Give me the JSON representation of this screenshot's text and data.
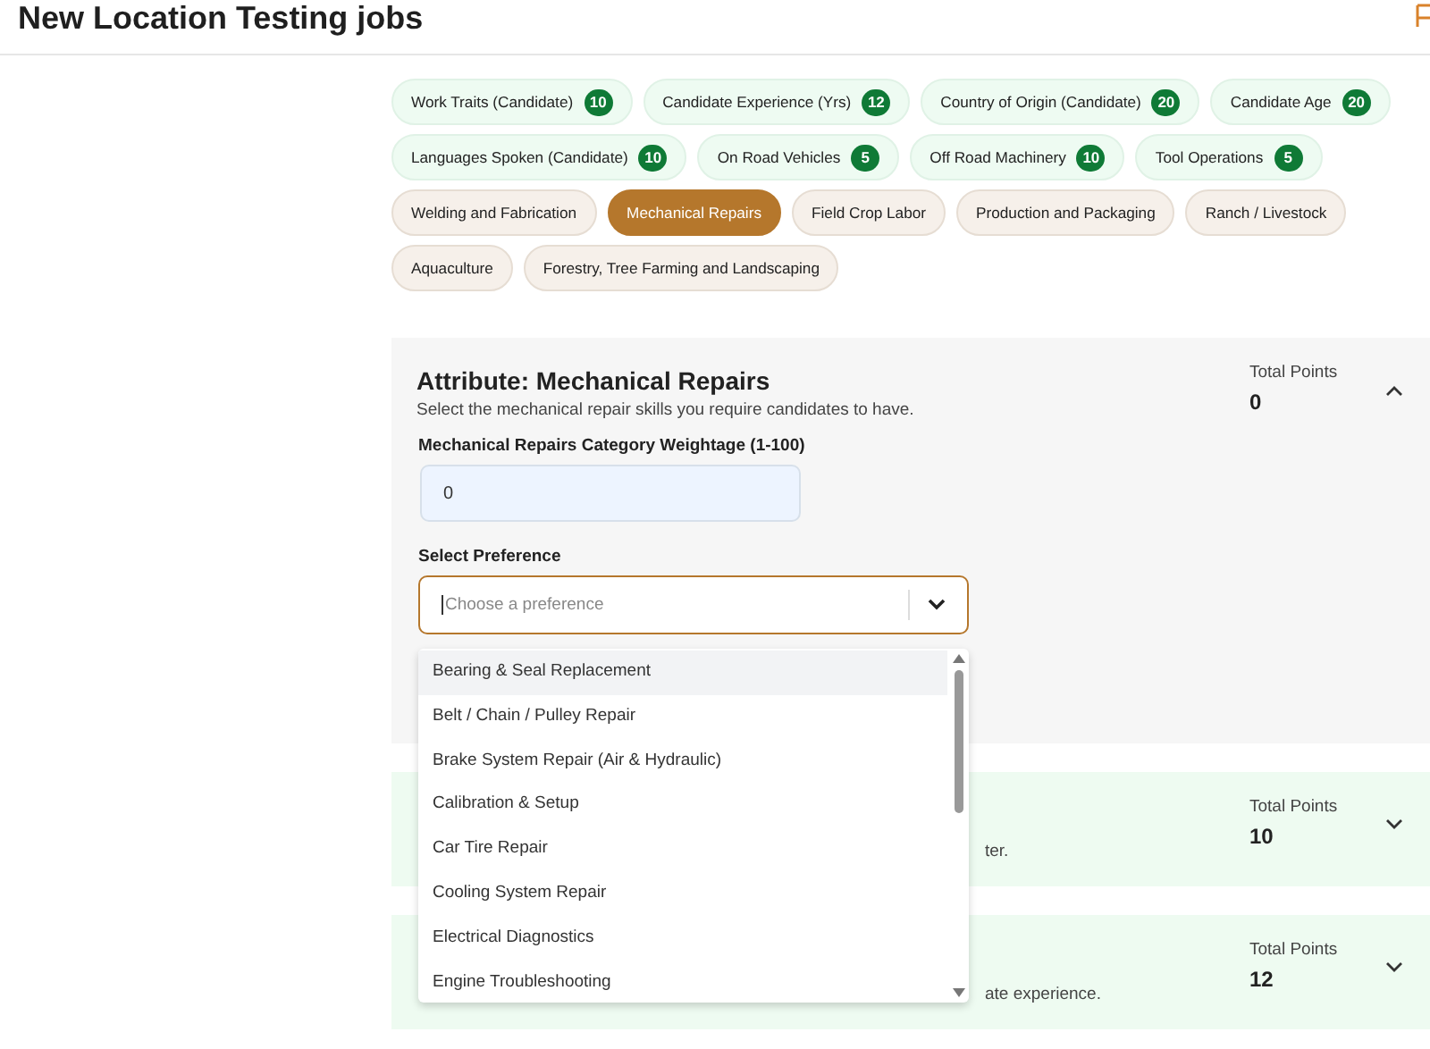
{
  "header": {
    "title": "New Location Testing jobs"
  },
  "attribute_chips": [
    {
      "label": "Work Traits (Candidate)",
      "count": "10"
    },
    {
      "label": "Candidate Experience (Yrs)",
      "count": "12"
    },
    {
      "label": "Country of Origin (Candidate)",
      "count": "20"
    },
    {
      "label": "Candidate Age",
      "count": "20"
    },
    {
      "label": "Languages Spoken (Candidate)",
      "count": "10"
    },
    {
      "label": "On Road Vehicles",
      "count": "5"
    },
    {
      "label": "Off Road Machinery",
      "count": "10"
    },
    {
      "label": "Tool Operations",
      "count": "5"
    }
  ],
  "category_chips": [
    {
      "label": "Welding and Fabrication",
      "selected": false
    },
    {
      "label": "Mechanical Repairs",
      "selected": true
    },
    {
      "label": "Field Crop Labor",
      "selected": false
    },
    {
      "label": "Production and Packaging",
      "selected": false
    },
    {
      "label": "Ranch / Livestock",
      "selected": false
    },
    {
      "label": "Aquaculture",
      "selected": false
    },
    {
      "label": "Forestry, Tree Farming and Landscaping",
      "selected": false
    }
  ],
  "attribute_panel": {
    "title": "Attribute: Mechanical Repairs",
    "description": "Select the mechanical repair skills you require candidates to have.",
    "total_label": "Total Points",
    "total": "0",
    "expanded": true,
    "weightage": {
      "label": "Mechanical Repairs Category Weightage (1-100)",
      "value": "0"
    },
    "preference": {
      "label": "Select Preference",
      "placeholder": "Choose a preference",
      "options": [
        {
          "label": "Bearing & Seal Replacement",
          "highlighted": true
        },
        {
          "label": "Belt / Chain / Pulley Repair",
          "highlighted": false
        },
        {
          "label": "Brake System Repair (Air & Hydraulic)",
          "highlighted": false
        },
        {
          "label": "Calibration & Setup",
          "highlighted": false
        },
        {
          "label": "Car Tire Repair",
          "highlighted": false
        },
        {
          "label": "Cooling System Repair",
          "highlighted": false
        },
        {
          "label": "Electrical Diagnostics",
          "highlighted": false
        },
        {
          "label": "Engine Troubleshooting",
          "highlighted": false
        }
      ]
    }
  },
  "other_panels": [
    {
      "description": "ter.",
      "total_label": "Total Points",
      "total": "10",
      "expanded": false
    },
    {
      "description": "ate experience.",
      "total_label": "Total Points",
      "total": "12",
      "expanded": false
    }
  ]
}
